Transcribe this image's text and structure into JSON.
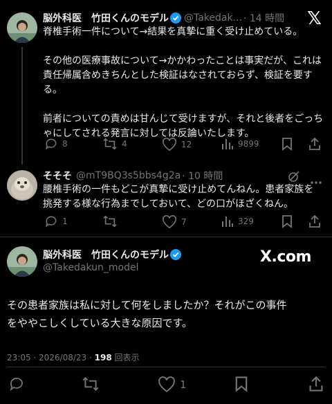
{
  "tweet1": {
    "name": "脳外科医　竹田くんのモデル",
    "handle": "@Takedak...",
    "time": "· 14 時間",
    "lines": [
      "脊椎手術一件について→結果を真摯に重く受け止めている。",
      "",
      "その他の医療事故について→かかわったことは事実だが、これは",
      "責任帰属含めきちんとした検証はなされておらず、検証を要す",
      "る。",
      "",
      "前者についての責めは甘んじて受けますが、それと後者をごっち",
      "ゃにしてされる発言に対しては反論いたします。"
    ],
    "replies": "8",
    "reposts": "4",
    "likes": "12",
    "views": "9899"
  },
  "tweet2": {
    "name": "そそそ",
    "handle": "@mT9BQ3s5bbs4g2a",
    "time": "· 10 時間",
    "lines": [
      "腰椎手術の一件もどこが真摯に受け止めてんねん。患者家族を",
      "挑発する様な行為までしておいて、どの口がほざくねん。"
    ],
    "replies": "1",
    "reposts": "",
    "likes": "7",
    "views": "329"
  },
  "tweet3": {
    "name": "脳外科医　竹田くんのモデル",
    "handle": "@Takedakun_model",
    "lines": [
      "その患者家族は私に対して何をしましたか？それがこの事件",
      "をややこしくしている大きな原因です。"
    ],
    "timestamp": "23:05 · 2026/08/23 ·",
    "view_count": "198",
    "view_label": "回表示",
    "likes": "1"
  },
  "watermark": {
    "x_logo": "𝕏",
    "xcom": "X.com"
  },
  "colors": {
    "verified": "#1d9bf0",
    "muted": "#71767b"
  }
}
